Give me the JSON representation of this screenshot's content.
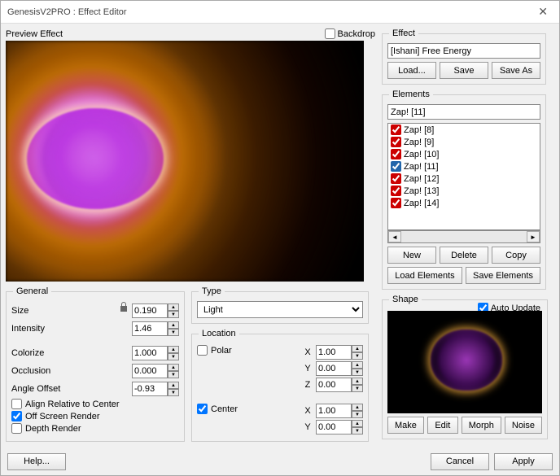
{
  "window": {
    "title": "GenesisV2PRO : Effect Editor"
  },
  "preview": {
    "label": "Preview Effect",
    "backdrop_label": "Backdrop"
  },
  "effect": {
    "legend": "Effect",
    "name": "[Ishani] Free Energy",
    "load": "Load...",
    "save": "Save",
    "saveas": "Save As"
  },
  "elements": {
    "legend": "Elements",
    "selected": "Zap! [11]",
    "items": [
      {
        "label": "Zap! [8]",
        "checked": true,
        "sel": false
      },
      {
        "label": "Zap! [9]",
        "checked": true,
        "sel": false
      },
      {
        "label": "Zap! [10]",
        "checked": true,
        "sel": false
      },
      {
        "label": "Zap! [11]",
        "checked": true,
        "sel": true
      },
      {
        "label": "Zap! [12]",
        "checked": true,
        "sel": false
      },
      {
        "label": "Zap! [13]",
        "checked": true,
        "sel": false
      },
      {
        "label": "Zap! [14]",
        "checked": true,
        "sel": false
      }
    ],
    "new": "New",
    "delete": "Delete",
    "copy": "Copy",
    "load_elems": "Load Elements",
    "save_elems": "Save Elements"
  },
  "general": {
    "legend": "General",
    "size_label": "Size",
    "size": "0.190",
    "intensity_label": "Intensity",
    "intensity": "1.46",
    "colorize_label": "Colorize",
    "colorize": "1.000",
    "occlusion_label": "Occlusion",
    "occlusion": "0.000",
    "angle_label": "Angle Offset",
    "angle": "-0.93",
    "align_label": "Align Relative to Center",
    "offscreen_label": "Off Screen Render",
    "depth_label": "Depth Render"
  },
  "type": {
    "legend": "Type",
    "value": "Light"
  },
  "location": {
    "legend": "Location",
    "polar_label": "Polar",
    "center_label": "Center",
    "x1": "1.00",
    "y1": "0.00",
    "z1": "0.00",
    "x2": "1.00",
    "y2": "0.00"
  },
  "shape": {
    "legend": "Shape",
    "auto_label": "Auto Update",
    "make": "Make",
    "edit": "Edit",
    "morph": "Morph",
    "noise": "Noise"
  },
  "footer": {
    "help": "Help...",
    "cancel": "Cancel",
    "apply": "Apply"
  }
}
